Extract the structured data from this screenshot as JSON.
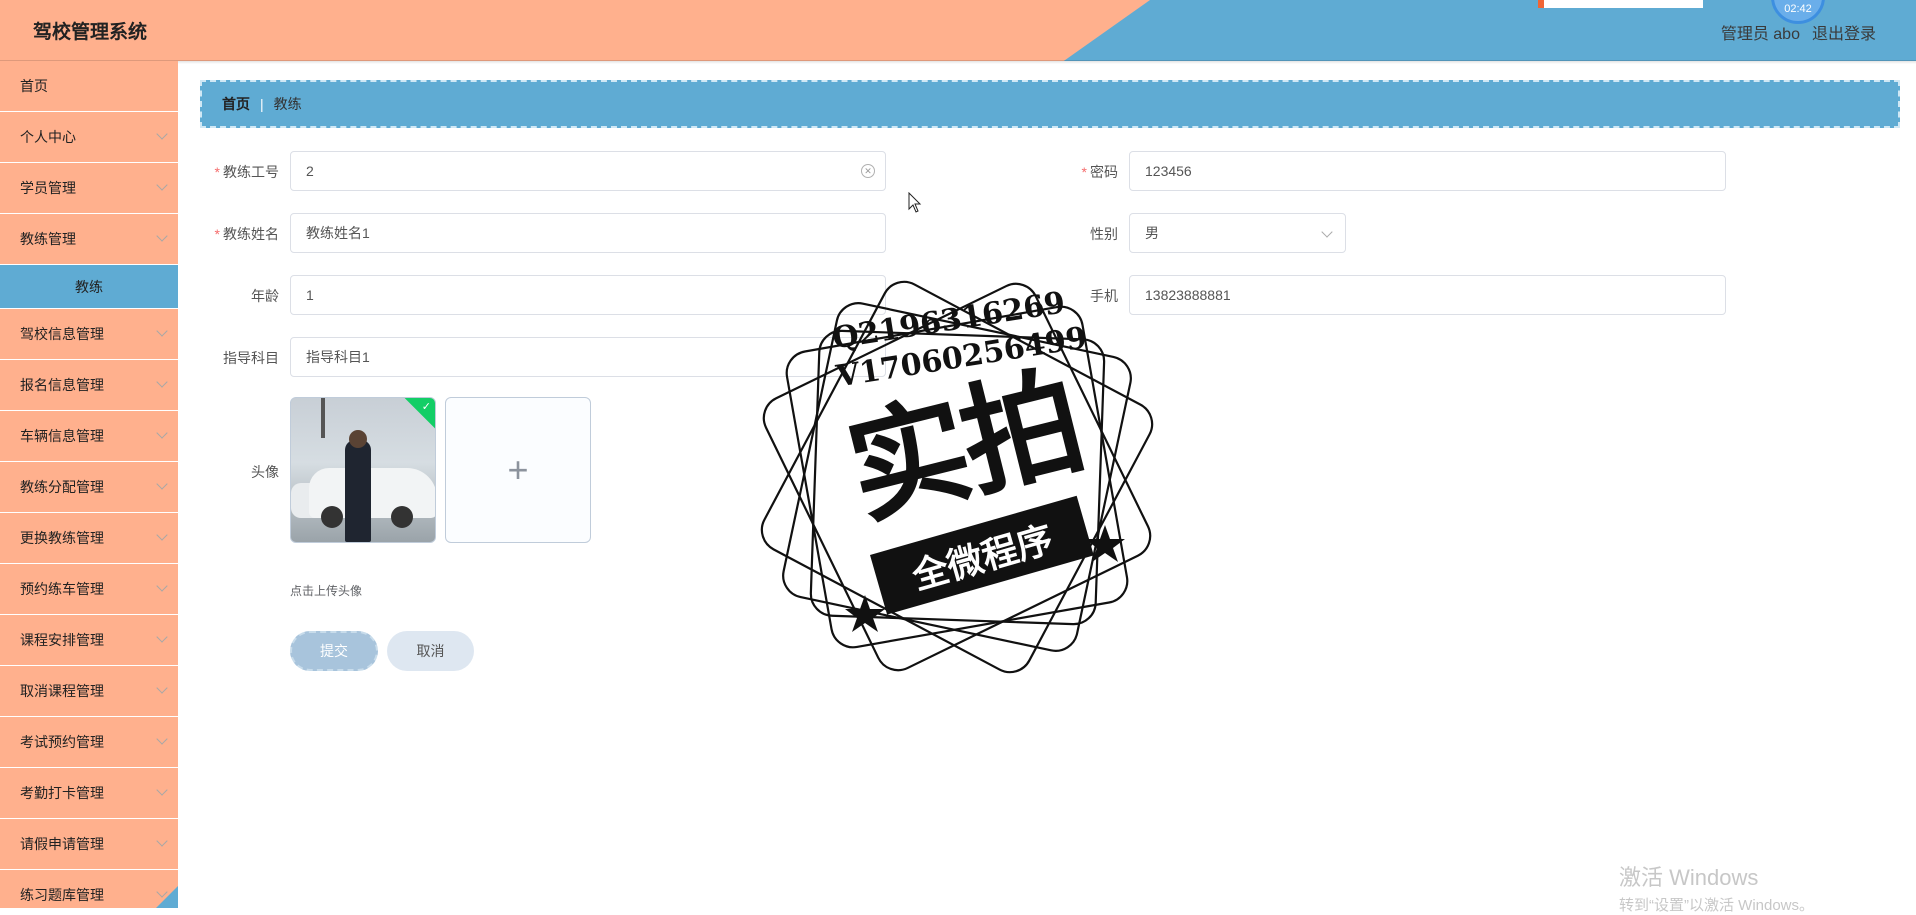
{
  "header": {
    "app_title": "驾校管理系统",
    "user_label": "管理员 abo",
    "logout_label": "退出登录",
    "clock_time": "02:42"
  },
  "sidebar": {
    "items": [
      {
        "label": "首页",
        "has_arrow": false
      },
      {
        "label": "个人中心",
        "has_arrow": true
      },
      {
        "label": "学员管理",
        "has_arrow": true
      },
      {
        "label": "教练管理",
        "has_arrow": true
      },
      {
        "label": "教练",
        "active": true
      },
      {
        "label": "驾校信息管理",
        "has_arrow": true
      },
      {
        "label": "报名信息管理",
        "has_arrow": true
      },
      {
        "label": "车辆信息管理",
        "has_arrow": true
      },
      {
        "label": "教练分配管理",
        "has_arrow": true
      },
      {
        "label": "更换教练管理",
        "has_arrow": true
      },
      {
        "label": "预约练车管理",
        "has_arrow": true
      },
      {
        "label": "课程安排管理",
        "has_arrow": true
      },
      {
        "label": "取消课程管理",
        "has_arrow": true
      },
      {
        "label": "考试预约管理",
        "has_arrow": true
      },
      {
        "label": "考勤打卡管理",
        "has_arrow": true
      },
      {
        "label": "请假申请管理",
        "has_arrow": true
      },
      {
        "label": "练习题库管理",
        "has_arrow": true
      }
    ]
  },
  "breadcrumb": {
    "home": "首页",
    "separator": "|",
    "current": "教练"
  },
  "form": {
    "coach_id": {
      "label": "教练工号",
      "value": "2",
      "required": true
    },
    "password": {
      "label": "密码",
      "value": "123456",
      "required": true
    },
    "coach_name": {
      "label": "教练姓名",
      "value": "教练姓名1",
      "required": true
    },
    "gender": {
      "label": "性别",
      "value": "男"
    },
    "age": {
      "label": "年龄",
      "value": "1"
    },
    "phone": {
      "label": "手机",
      "value": "13823888881"
    },
    "subject": {
      "label": "指导科目",
      "value": "指导科目1"
    },
    "avatar": {
      "label": "头像",
      "upload_tip": "点击上传头像"
    },
    "submit_label": "提交",
    "cancel_label": "取消"
  },
  "watermark": {
    "line1": "Q2196316269",
    "line2": "V17060256499",
    "big_text": "实拍",
    "banner_text": "全微程序"
  },
  "os_overlay": {
    "activate_title": "激活 Windows",
    "activate_sub": "转到“设置”以激活 Windows。"
  }
}
